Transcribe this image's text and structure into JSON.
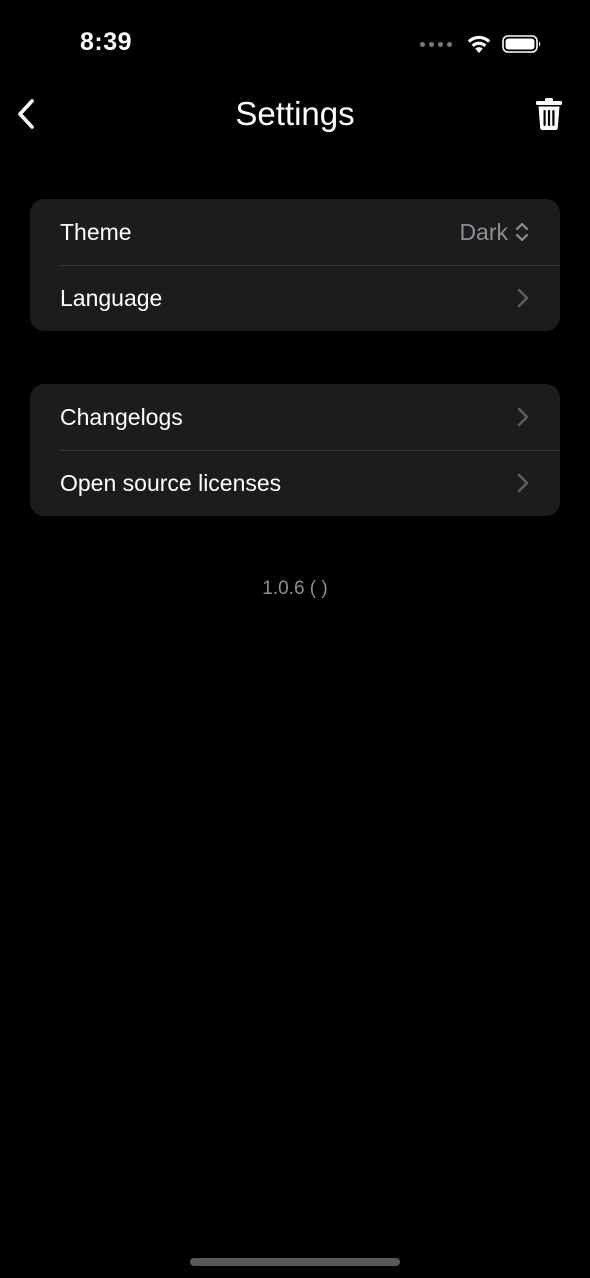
{
  "status_bar": {
    "time": "8:39"
  },
  "nav": {
    "title": "Settings"
  },
  "groups": [
    {
      "rows": [
        {
          "label": "Theme",
          "value": "Dark"
        },
        {
          "label": "Language"
        }
      ]
    },
    {
      "rows": [
        {
          "label": "Changelogs"
        },
        {
          "label": "Open source licenses"
        }
      ]
    }
  ],
  "footer": {
    "version": "1.0.6 (  )"
  },
  "colors": {
    "background": "#000000",
    "group_background": "#1c1c1e",
    "separator": "#38383a",
    "secondary_text": "#8e8e93"
  },
  "icons": {
    "back": "chevron-left-icon",
    "delete": "trash-icon",
    "theme_picker": "chevron-up-down-icon",
    "row_disclosure": "chevron-right-icon"
  }
}
